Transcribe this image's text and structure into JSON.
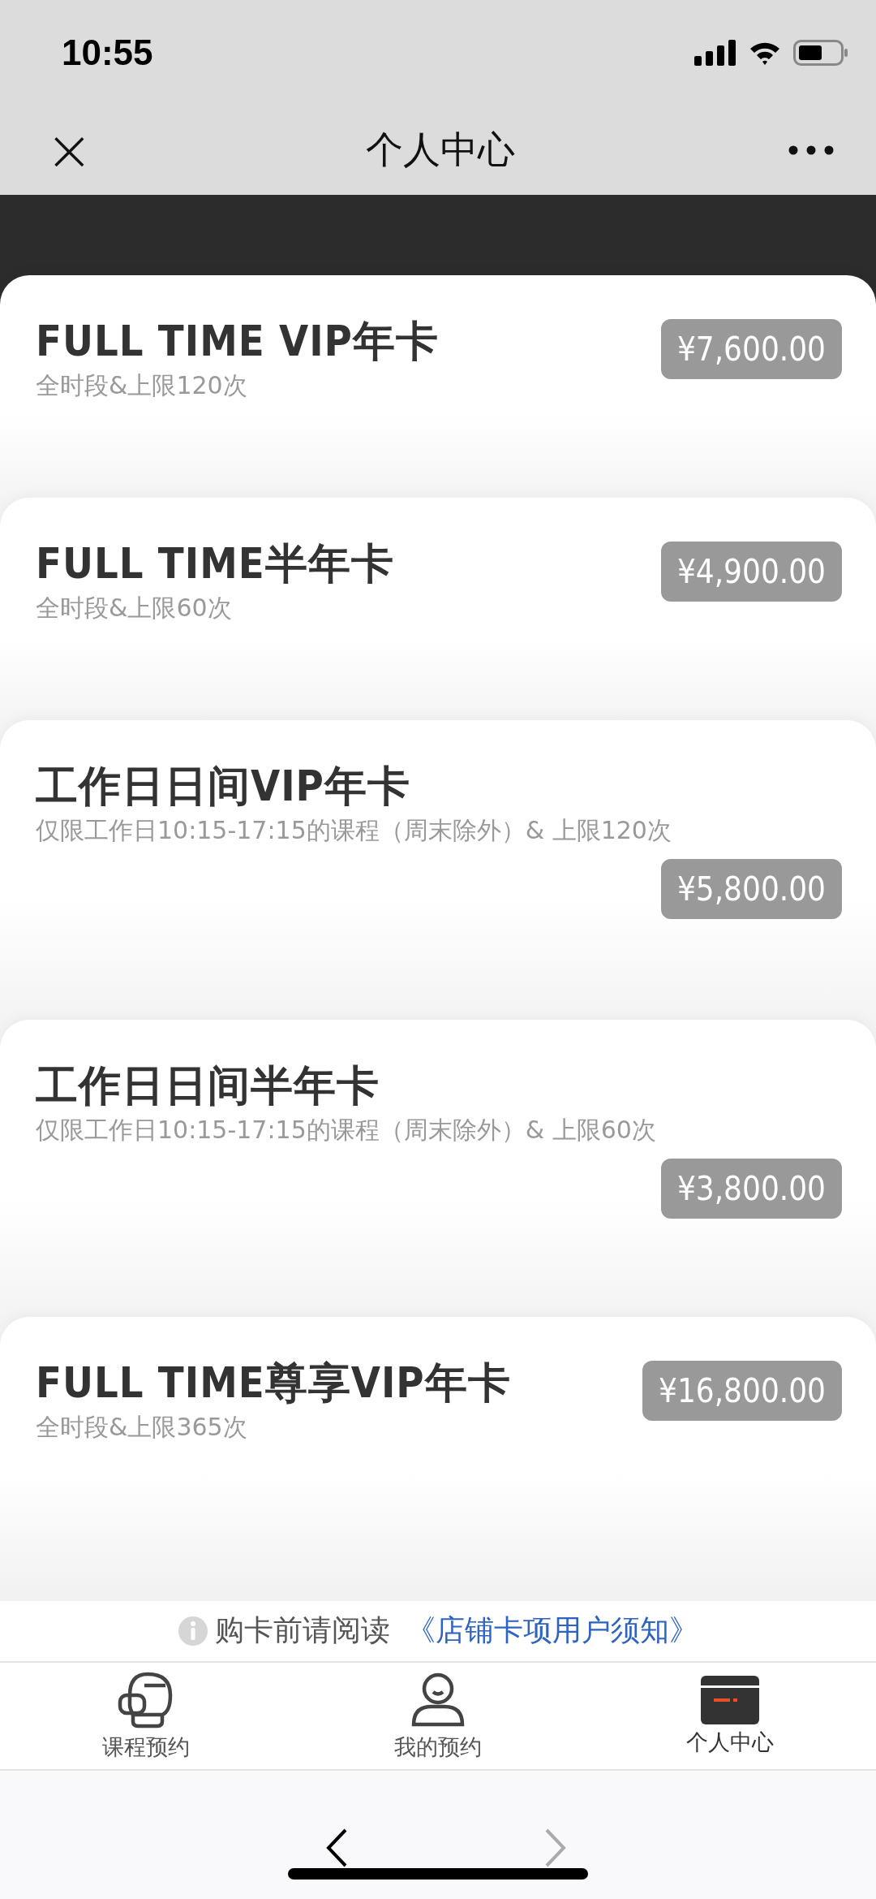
{
  "status_bar": {
    "time": "10:55"
  },
  "header": {
    "title": "个人中心",
    "close": "×"
  },
  "cards": [
    {
      "kind": "inline",
      "name": "FULL TIME VIP年卡",
      "desc": "全时段&上限120次",
      "price": "¥7,600.00"
    },
    {
      "kind": "inline",
      "name": "FULL TIME半年卡",
      "desc": "全时段&上限60次",
      "price": "¥4,900.00"
    },
    {
      "kind": "stacked",
      "name": "工作日日间VIP年卡",
      "desc": "仅限工作日10:15-17:15的课程（周末除外）& 上限120次",
      "price": "¥5,800.00"
    },
    {
      "kind": "stacked",
      "name": "工作日日间半年卡",
      "desc": "仅限工作日10:15-17:15的课程（周末除外）& 上限60次",
      "price": "¥3,800.00"
    },
    {
      "kind": "inline",
      "name": "FULL TIME尊享VIP年卡",
      "desc": "全时段&上限365次",
      "price": "¥16,800.00"
    }
  ],
  "notice": {
    "text": "购卡前请阅读",
    "link": "《店铺卡项用户须知》"
  },
  "tabs": [
    {
      "kind": "glove",
      "label": "课程预约",
      "selected": false
    },
    {
      "kind": "person",
      "label": "我的预约",
      "selected": false
    },
    {
      "kind": "card",
      "label": "个人中心",
      "selected": true
    }
  ],
  "browser": {
    "back_disabled": false,
    "forward_disabled": true
  }
}
